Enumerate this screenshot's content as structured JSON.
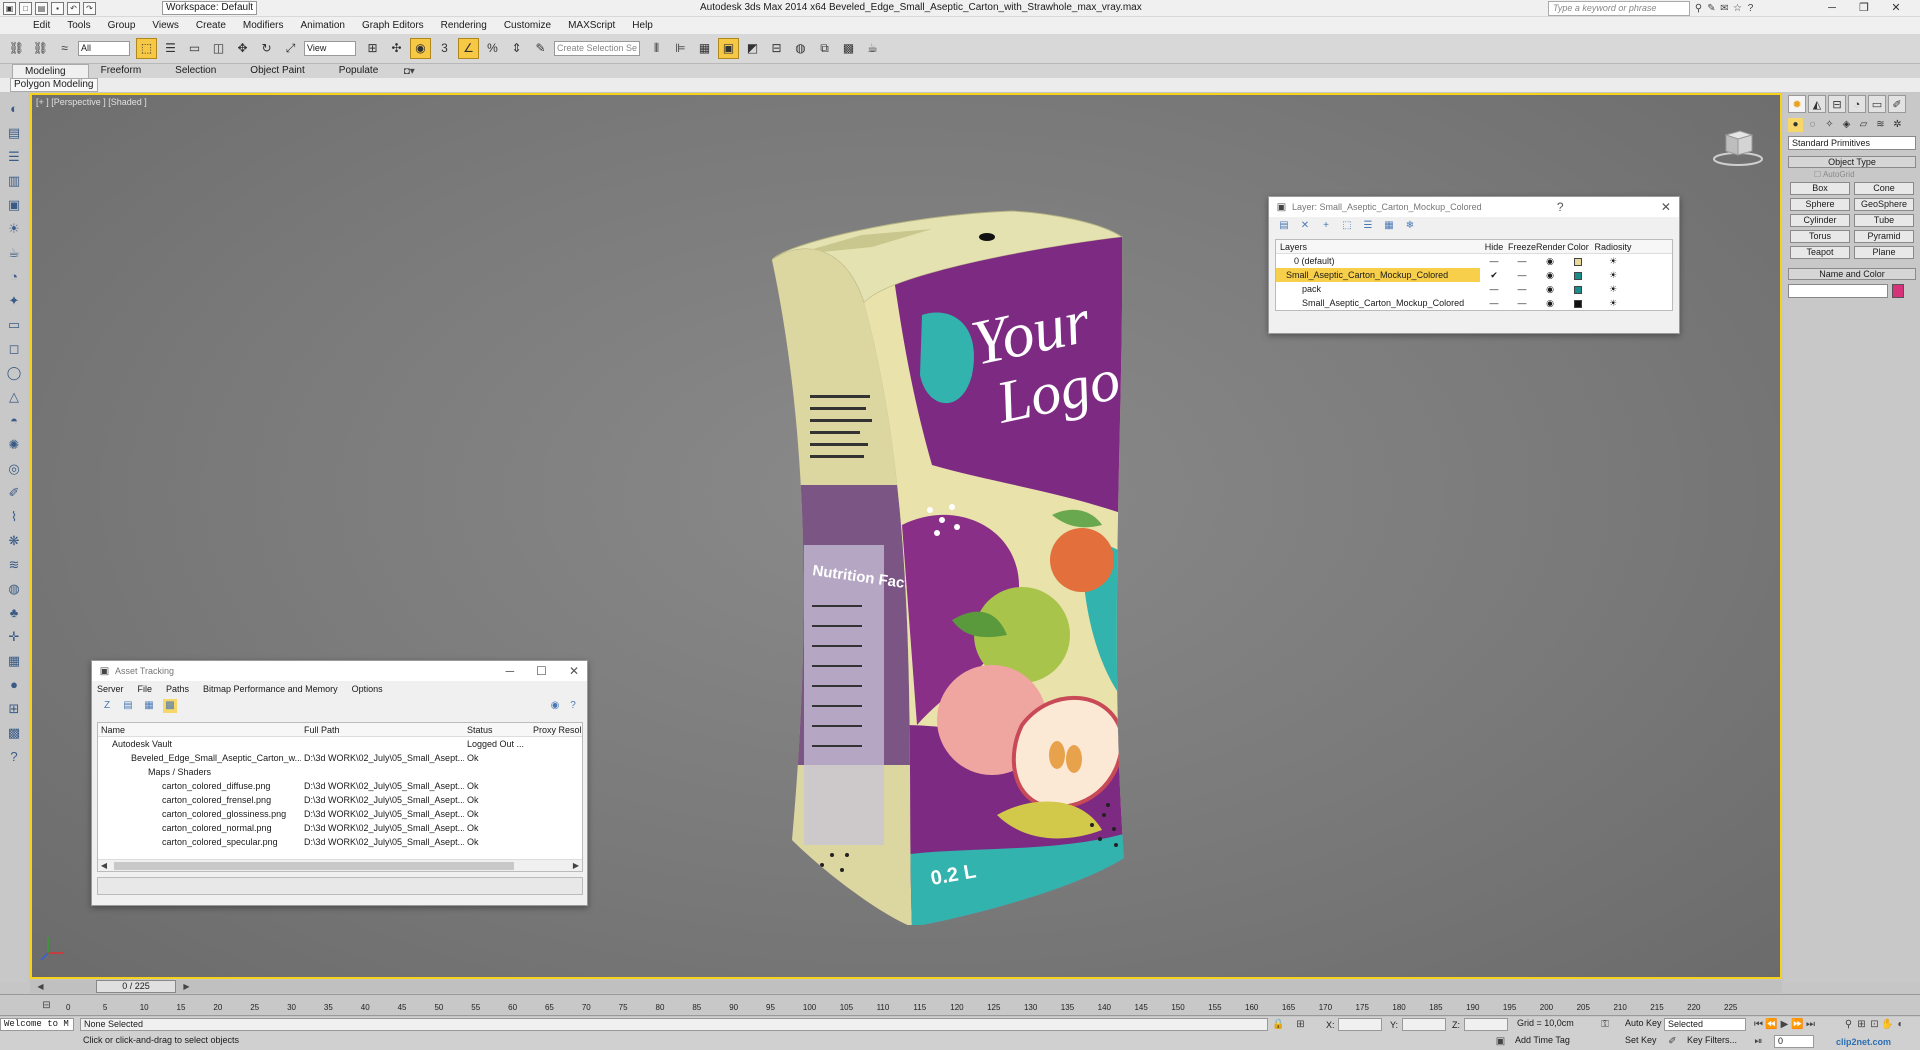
{
  "titlebar": {
    "workspace": "Workspace: Default",
    "app_title": "Autodesk 3ds Max  2014 x64     Beveled_Edge_Small_Aseptic_Carton_with_Strawhole_max_vray.max",
    "help_search_placeholder": "Type a keyword or phrase",
    "window_buttons": [
      "─",
      "❐",
      "✕"
    ]
  },
  "menu": [
    "Edit",
    "Tools",
    "Group",
    "Views",
    "Create",
    "Modifiers",
    "Animation",
    "Graph Editors",
    "Rendering",
    "Customize",
    "MAXScript",
    "Help"
  ],
  "toolbar": {
    "filter_value": "All",
    "refcoord_value": "View",
    "named_selection_placeholder": "Create Selection Se"
  },
  "ribbon": {
    "tabs": [
      "Modeling",
      "Freeform",
      "Selection",
      "Object Paint",
      "Populate"
    ],
    "active_tab": "Modeling",
    "sub_label": "Polygon Modeling"
  },
  "viewport": {
    "label": "[+ ] [Perspective ] [Shaded ]"
  },
  "carton": {
    "logo_line1": "Your",
    "logo_line2": "Logo",
    "volume": "0.2 L",
    "side_title": "Nutrition Facts",
    "colors": {
      "purple": "#7d2a82",
      "teal": "#33b3ad",
      "cream": "#e9e2ab",
      "top": "#d4d39a",
      "orange": "#e26f3c",
      "green": "#a8c44a",
      "pink": "#f0a6a0"
    }
  },
  "layer_dialog": {
    "title": "Layer: Small_Aseptic_Carton_Mockup_Colored",
    "columns": [
      "Layers",
      "Hide",
      "Freeze",
      "Render",
      "Color",
      "Radiosity"
    ],
    "rows": [
      {
        "name": "0 (default)",
        "color": "#e8d89a"
      },
      {
        "name": "Small_Aseptic_Carton_Mockup_Colored",
        "color": "#1a8c8c",
        "current": "✔"
      },
      {
        "name": "pack",
        "color": "#1a8c8c"
      },
      {
        "name": "Small_Aseptic_Carton_Mockup_Colored",
        "color": "#111111"
      }
    ]
  },
  "asset_tracking": {
    "title": "Asset Tracking",
    "menu": [
      "Server",
      "File",
      "Paths",
      "Bitmap Performance and Memory",
      "Options"
    ],
    "columns": [
      "Name",
      "Full Path",
      "Status",
      "Proxy Resol..."
    ],
    "rows": [
      {
        "name": "Autodesk Vault",
        "path": "",
        "status": "Logged Out ...",
        "indent": 1
      },
      {
        "name": "Beveled_Edge_Small_Aseptic_Carton_w...",
        "path": "D:\\3d WORK\\02_July\\05_Small_Asept...",
        "status": "Ok",
        "indent": 2
      },
      {
        "name": "Maps / Shaders",
        "path": "",
        "status": "",
        "indent": 3
      },
      {
        "name": "carton_colored_diffuse.png",
        "path": "D:\\3d WORK\\02_July\\05_Small_Asept...",
        "status": "Ok",
        "indent": 4
      },
      {
        "name": "carton_colored_frensel.png",
        "path": "D:\\3d WORK\\02_July\\05_Small_Asept...",
        "status": "Ok",
        "indent": 4
      },
      {
        "name": "carton_colored_glossiness.png",
        "path": "D:\\3d WORK\\02_July\\05_Small_Asept...",
        "status": "Ok",
        "indent": 4
      },
      {
        "name": "carton_colored_normal.png",
        "path": "D:\\3d WORK\\02_July\\05_Small_Asept...",
        "status": "Ok",
        "indent": 4
      },
      {
        "name": "carton_colored_specular.png",
        "path": "D:\\3d WORK\\02_July\\05_Small_Asept...",
        "status": "Ok",
        "indent": 4
      }
    ]
  },
  "command_panel": {
    "category": "Standard Primitives",
    "object_type_title": "Object Type",
    "autogrid": "AutoGrid",
    "buttons": [
      "Box",
      "Cone",
      "Sphere",
      "GeoSphere",
      "Cylinder",
      "Tube",
      "Torus",
      "Pyramid",
      "Teapot",
      "Plane"
    ],
    "name_color_title": "Name and Color",
    "name_color_swatch": "#d6337a"
  },
  "timeline": {
    "slider": "0 / 225",
    "ticks": [
      "0",
      "5",
      "10",
      "15",
      "20",
      "25",
      "30",
      "35",
      "40",
      "45",
      "50",
      "55",
      "60",
      "65",
      "70",
      "75",
      "80",
      "85",
      "90",
      "95",
      "100",
      "105",
      "110",
      "115",
      "120",
      "125",
      "130",
      "135",
      "140",
      "145",
      "150",
      "155",
      "160",
      "165",
      "170",
      "175",
      "180",
      "185",
      "190",
      "195",
      "200",
      "205",
      "210",
      "215",
      "220",
      "225"
    ]
  },
  "status": {
    "welcome": "Welcome to M",
    "selection": "None Selected",
    "prompt": "Click or click-and-drag to select objects",
    "x_label": "X:",
    "y_label": "Y:",
    "z_label": "Z:",
    "grid": "Grid = 10,0cm",
    "add_time_tag": "Add Time Tag",
    "auto_key": "Auto Key",
    "set_key": "Set Key",
    "selected": "Selected",
    "key_filters": "Key Filters...",
    "frame": "0",
    "watermark": "clip2net.com"
  }
}
